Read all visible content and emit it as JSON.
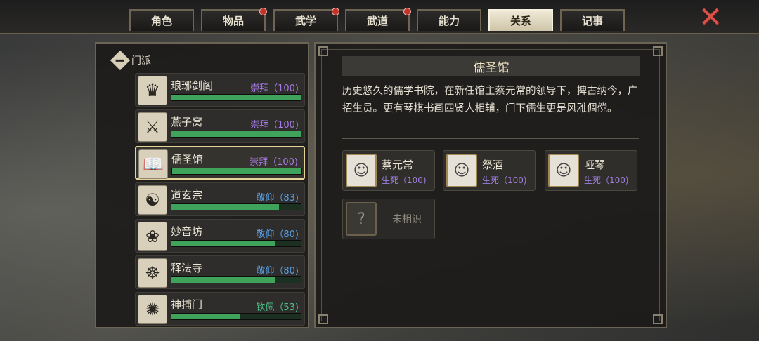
{
  "tabs": [
    {
      "label": "角色",
      "badge": false,
      "active": false
    },
    {
      "label": "物品",
      "badge": true,
      "active": false
    },
    {
      "label": "武学",
      "badge": true,
      "active": false
    },
    {
      "label": "武道",
      "badge": true,
      "active": false
    },
    {
      "label": "能力",
      "badge": false,
      "active": false
    },
    {
      "label": "关系",
      "badge": false,
      "active": true
    },
    {
      "label": "记事",
      "badge": false,
      "active": false
    }
  ],
  "close_icon": "close-x-icon",
  "section": {
    "label": "门派"
  },
  "factions": [
    {
      "name": "琅琊剑阁",
      "status": "崇拜（100)",
      "value": 100,
      "max": 100,
      "status_color": "#a77be6",
      "icon": "crown-icon",
      "glyph": "♛",
      "selected": false
    },
    {
      "name": "燕子窝",
      "status": "崇拜（100)",
      "value": 100,
      "max": 100,
      "status_color": "#a77be6",
      "icon": "crossed-blades-icon",
      "glyph": "⚔",
      "selected": false
    },
    {
      "name": "儒圣馆",
      "status": "崇拜（100)",
      "value": 100,
      "max": 100,
      "status_color": "#a77be6",
      "icon": "book-icon",
      "glyph": "📖",
      "selected": true
    },
    {
      "name": "道玄宗",
      "status": "敬仰（83)",
      "value": 83,
      "max": 100,
      "status_color": "#5aa0e6",
      "icon": "yin-yang-icon",
      "glyph": "☯",
      "selected": false
    },
    {
      "name": "妙音坊",
      "status": "敬仰（80)",
      "value": 80,
      "max": 100,
      "status_color": "#5aa0e6",
      "icon": "lotus-icon",
      "glyph": "❀",
      "selected": false
    },
    {
      "name": "释法寺",
      "status": "敬仰（80)",
      "value": 80,
      "max": 100,
      "status_color": "#5aa0e6",
      "icon": "buddha-icon",
      "glyph": "☸",
      "selected": false
    },
    {
      "name": "神捕门",
      "status": "钦佩（53)",
      "value": 53,
      "max": 100,
      "status_color": "#4fc28a",
      "icon": "badge-icon",
      "glyph": "✺",
      "selected": false
    }
  ],
  "detail": {
    "title": "儒圣馆",
    "description": "历史悠久的儒学书院，在新任馆主蔡元常的领导下，捭古纳今，广招生员。更有琴棋书画四贤人相辅，门下儒生更是风雅倜傥。",
    "members": [
      {
        "name": "蔡元常",
        "status": "生死（100)",
        "icon": "portrait-elder-icon"
      },
      {
        "name": "祭酒",
        "status": "生死（100)",
        "icon": "portrait-scholar-icon"
      },
      {
        "name": "哑琴",
        "status": "生死（100)",
        "icon": "portrait-musician-icon"
      }
    ],
    "unknown": {
      "label": "未相识",
      "glyph": "?"
    }
  }
}
